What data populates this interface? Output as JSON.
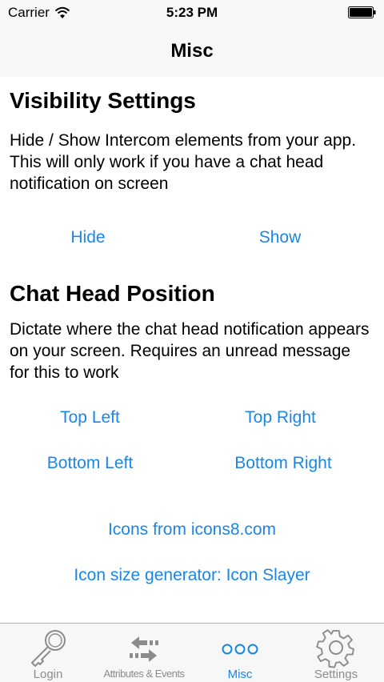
{
  "status_bar": {
    "carrier": "Carrier",
    "time": "5:23 PM"
  },
  "nav": {
    "title": "Misc"
  },
  "visibility": {
    "title": "Visibility Settings",
    "description": "Hide / Show Intercom elements from your app. This will only work if you have a chat head notification on screen",
    "hide_label": "Hide",
    "show_label": "Show"
  },
  "chat_head": {
    "title": "Chat Head Position",
    "description": "Dictate where the chat head notification appears on your screen. Requires an unread message for this to work",
    "top_left": "Top Left",
    "top_right": "Top Right",
    "bottom_left": "Bottom Left",
    "bottom_right": "Bottom Right"
  },
  "credits": {
    "icons_link": "Icons from icons8.com",
    "generator_link": "Icon size generator: Icon Slayer"
  },
  "tabs": [
    {
      "label": "Login",
      "icon": "key-icon"
    },
    {
      "label": "Attributes & Events",
      "icon": "arrows-exchange-icon"
    },
    {
      "label": "Misc",
      "icon": "more-dots-icon"
    },
    {
      "label": "Settings",
      "icon": "gear-icon"
    }
  ],
  "colors": {
    "accent": "#1a86e8",
    "inactive": "#8c8c8c",
    "bar_background": "#f7f7f7"
  }
}
